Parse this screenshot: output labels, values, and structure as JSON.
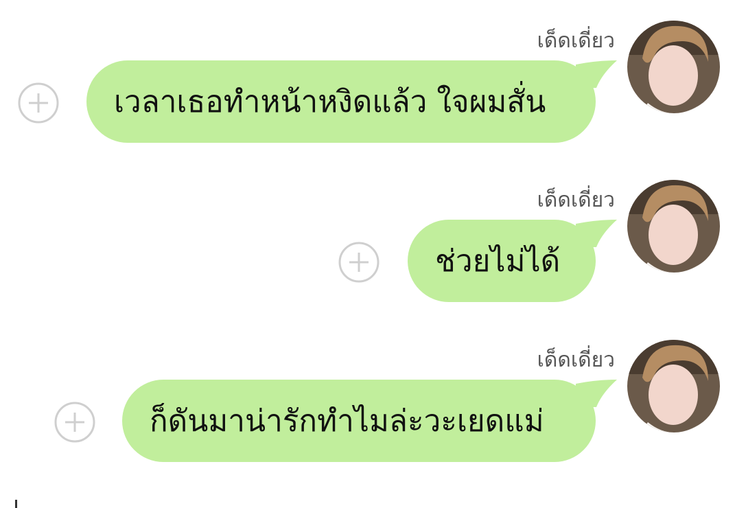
{
  "chat": {
    "messages": [
      {
        "sender": "เด็ดเดี่ยว",
        "text": "เวลาเธอทำหน้าหงิดแล้ว ใจผมสั่น"
      },
      {
        "sender": "เด็ดเดี่ยว",
        "text": "ช่วยไม่ได้"
      },
      {
        "sender": "เด็ดเดี่ยว",
        "text": "ก็ดันมาน่ารักทำไมล่ะวะเยดแม่"
      }
    ]
  },
  "colors": {
    "bubble": "#c1ee9c",
    "add_icon_stroke": "#cfcfcf",
    "sender_text": "#555555"
  },
  "icons": {
    "add": "circle-plus",
    "avatar": "profile-photo"
  }
}
